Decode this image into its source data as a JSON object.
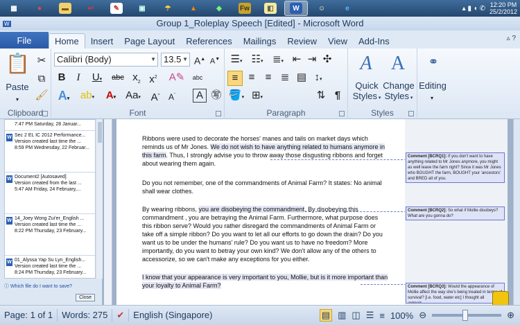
{
  "taskbar": {
    "items": [
      {
        "icon": "windows-explorer-icon",
        "glyph": "▦"
      },
      {
        "icon": "chrome-icon",
        "glyph": "●"
      },
      {
        "icon": "folder-icon",
        "glyph": "▬"
      },
      {
        "icon": "app-red-icon",
        "glyph": "↩"
      },
      {
        "icon": "paint-icon",
        "glyph": "✎"
      },
      {
        "icon": "photo-icon",
        "glyph": "▣"
      },
      {
        "icon": "weather-icon",
        "glyph": "☂"
      },
      {
        "icon": "vlc-icon",
        "glyph": "▲"
      },
      {
        "icon": "app-colorful-icon",
        "glyph": "◈"
      },
      {
        "icon": "fireworks-icon",
        "glyph": "Fw"
      },
      {
        "icon": "notes-icon",
        "glyph": "◧"
      },
      {
        "icon": "word-icon",
        "glyph": "W"
      },
      {
        "icon": "user-icon",
        "glyph": "☺"
      },
      {
        "icon": "internet-explorer-icon",
        "glyph": "e"
      }
    ],
    "time": "12:20 PM",
    "date": "25/2/2012"
  },
  "title": "Group 1_Roleplay Speech [Edited]  -  Microsoft Word",
  "tabs": [
    {
      "label": "File"
    },
    {
      "label": "Home"
    },
    {
      "label": "Insert"
    },
    {
      "label": "Page Layout"
    },
    {
      "label": "References"
    },
    {
      "label": "Mailings"
    },
    {
      "label": "Review"
    },
    {
      "label": "View"
    },
    {
      "label": "Add-Ins"
    }
  ],
  "ribbon": {
    "clipboard": {
      "paste_label": "Paste",
      "group_label": "Clipboard"
    },
    "font": {
      "font_name": "Calibri (Body)",
      "font_size": "13.5",
      "group_label": "Font"
    },
    "paragraph": {
      "group_label": "Paragraph"
    },
    "styles": {
      "quick_styles": "Quick",
      "quick_styles_2": "Styles",
      "change_styles": "Change",
      "change_styles_2": "Styles",
      "group_label": "Styles"
    },
    "editing": {
      "label": "Editing"
    }
  },
  "nav_pane": {
    "top_item": "7:47 PM Saturday, 28 Januar...",
    "items": [
      {
        "name": "Sec 2 EL IC 2012 Performance...",
        "line2": "Version created last time the ...",
        "line3": "8:59 PM Wednesday, 22 Februar..."
      },
      {
        "name": "Document2  [Autosaved]",
        "line2": "Version created from the last ...",
        "line3": "5:47 AM Friday, 24 February,..."
      },
      {
        "name": "14_Joey Wong Zui'er_English ...",
        "line2": "Version created last time the ...",
        "line3": "8:22 PM Thursday, 23 February..."
      },
      {
        "name": "01_Alyssa Yap Su Lyn_English...",
        "line2": "Version created last time the ...",
        "line3": "8:24 PM Thursday, 23 February..."
      }
    ],
    "help_link": "Which file do I want to save?",
    "close_label": "Close"
  },
  "document": {
    "p1_a": "Ribbons  were used to decorate the horses'  manes and tails on market days which reminds us of Mr Jones. ",
    "p1_hl": "We do not wish to have anything related to humans anymore in this farm",
    "p1_b": ". Thus,  I  strongly advise you to throw away those disgusting ribbons and forget about wearing them again.",
    "p2": "Do you not remember,  one of the commandments of Animal Farm? It states:  No animal shall wear clothes.",
    "p3_a": "By wearing ribbons, ",
    "p3_hl": "you are disobeying the commandment",
    "p3_b": ". By disobeying this commandment , you are betraying the Animal Farm. Furthermore, what purpose does this ribbon serve? Would you rather disregard  the commandments of Animal Farm or take off a simple ribbon? Do you want to let all our efforts to go down the drain? Do you want us to be under the humans'  rule? Do you want us to have no freedom? More importantly,  do you want to betray your own kind? We don't  allow any of the others to accessorize,  so we can't make any exceptions  for you either.",
    "p4_hl": "I know that your appearance  is very important  to you, Mollie, but is it more important than your loyalty to Animal Farm?"
  },
  "comments": [
    {
      "tag": "Comment [BCRQ1]:",
      "text": " If you don't want to have anything related to Mr Jones anymore, you might as well leave the farm right? Since it was Mr Jones who BOUGHT the farm, BOUGHT your 'ancestors' and BRED all of you."
    },
    {
      "tag": "Comment [BCRQ2]:",
      "text": " So what if Mollie disobeys? What are you gonna do?"
    },
    {
      "tag": "Comment [BCRQ3]:",
      "text": " Would the appearance of Mollie affect the way she's being treated in terms of survival? [i.e. food, water etc] I thought all animals..."
    }
  ],
  "status": {
    "page": "Page: 1 of 1",
    "words": "Words: 275",
    "language": "English (Singapore)",
    "zoom": "100%"
  },
  "colors": {
    "accent": "#2b5797",
    "file_tab": "#2a5aa7",
    "comment_border": "#6a78c8"
  }
}
